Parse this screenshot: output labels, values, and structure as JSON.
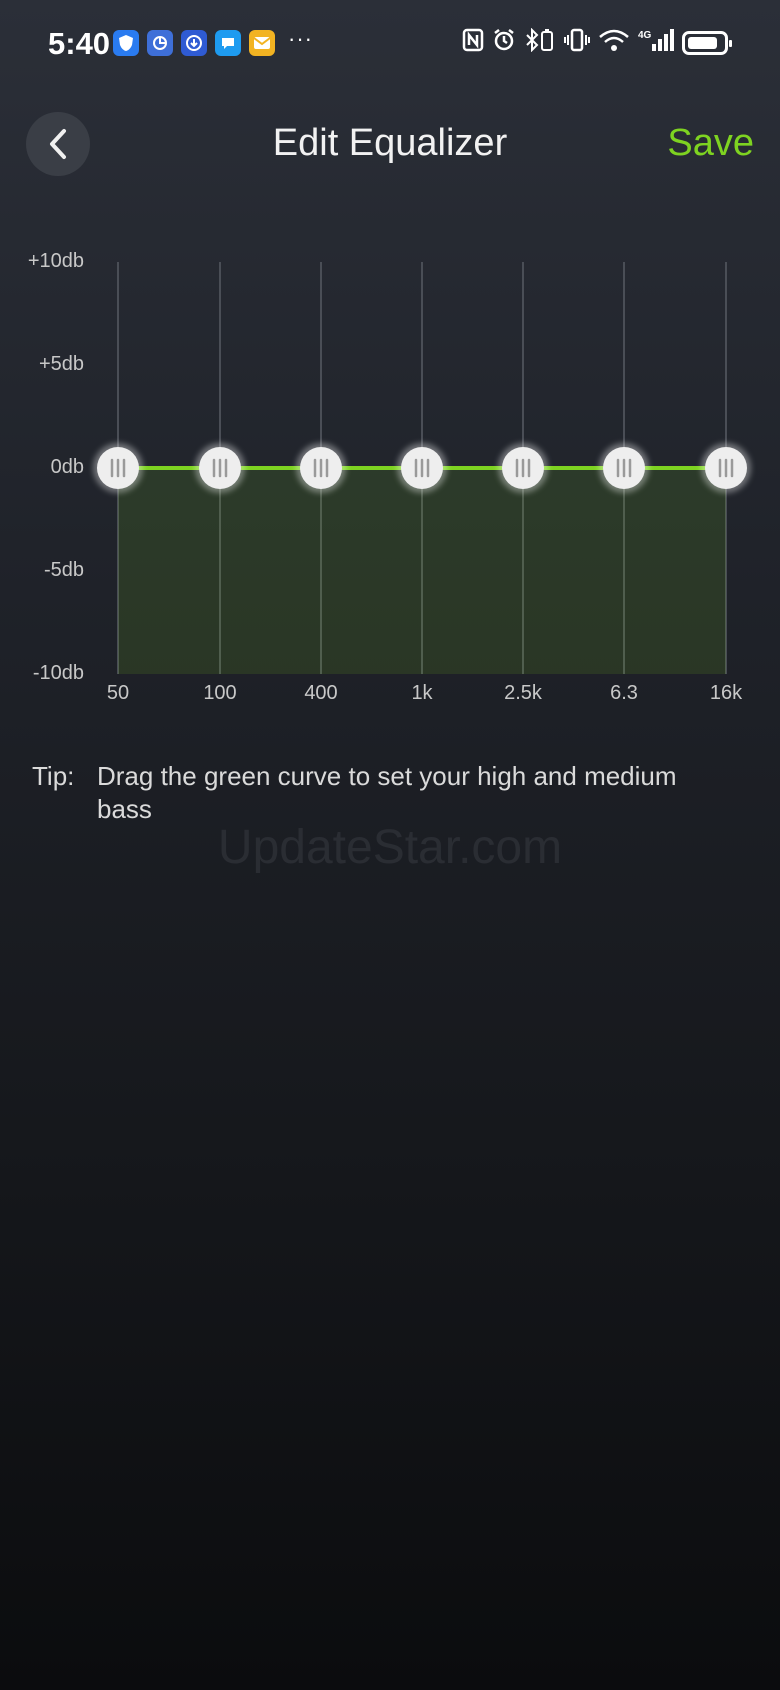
{
  "status_bar": {
    "time": "5:40",
    "app_icons": [
      "shield-app-icon",
      "browser-app-icon",
      "download-app-icon",
      "chat-app-icon",
      "mail-app-icon"
    ],
    "more": "···",
    "network": "4G"
  },
  "header": {
    "title": "Edit Equalizer",
    "save_label": "Save"
  },
  "equalizer": {
    "y_labels": [
      "+10db",
      "+5db",
      "0db",
      "-5db",
      "-10db"
    ],
    "bands": [
      "50",
      "100",
      "400",
      "1k",
      "2.5k",
      "6.3",
      "16k"
    ],
    "gains_db": [
      0,
      0,
      0,
      0,
      0,
      0,
      0
    ],
    "range_db": [
      -10,
      10
    ],
    "curve_color": "#7ed321"
  },
  "tip": {
    "label": "Tip:",
    "text": "Drag the green curve to set your high and medium bass"
  },
  "watermark": "UpdateStar.com",
  "colors": {
    "accent": "#7ed321",
    "background_top": "#2b2f38",
    "background_bottom": "#0b0c0e"
  }
}
